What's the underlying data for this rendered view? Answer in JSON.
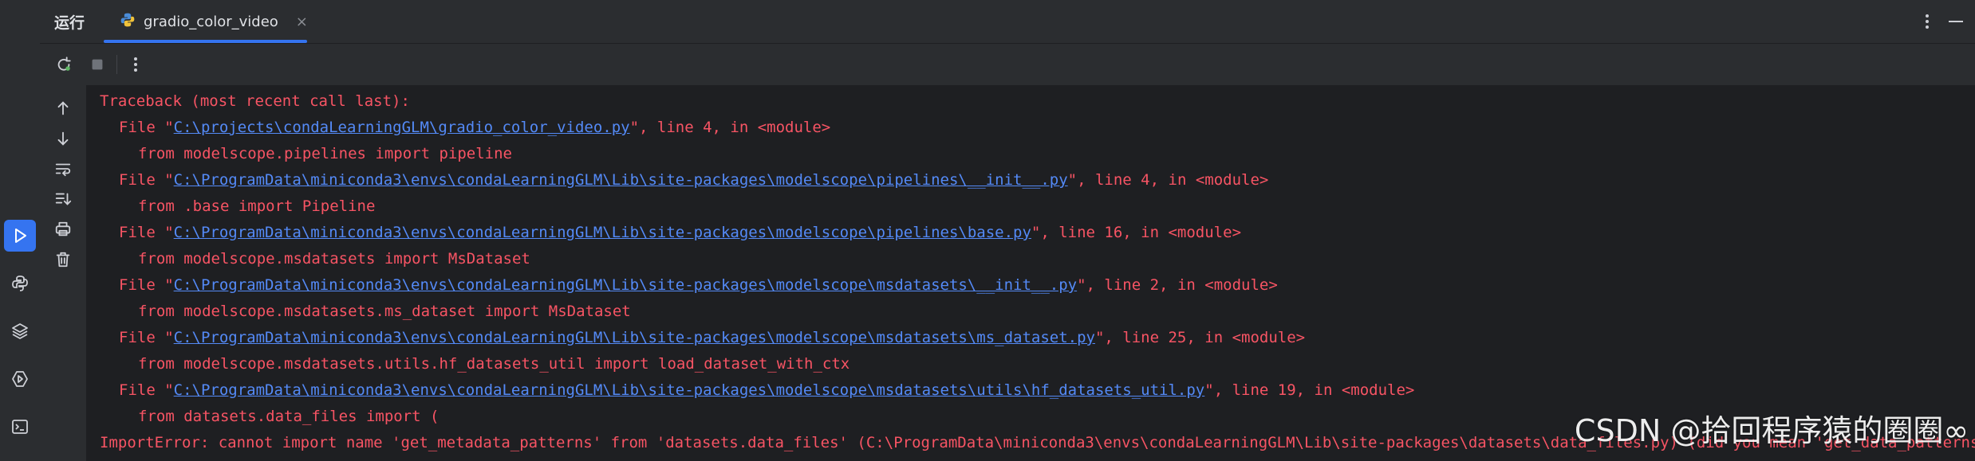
{
  "header": {
    "run_title": "运行",
    "tab_label": "gradio_color_video",
    "tab_close": "×"
  },
  "icons": {
    "activity": [
      "run-icon",
      "python-packages-icon",
      "layers-icon",
      "services-icon",
      "terminal-icon"
    ],
    "toolbar": [
      "rerun-icon",
      "stop-icon",
      "more-icon"
    ],
    "sidebar": [
      "scroll-up-icon",
      "scroll-down-icon",
      "soft-wrap-icon",
      "scroll-to-end-icon",
      "print-icon",
      "clear-all-icon"
    ]
  },
  "colors": {
    "error_text": "#f75464",
    "link": "#548af7",
    "accent": "#3574f0",
    "panel_bg": "#2b2d30",
    "console_bg": "#1e1f22"
  },
  "console": {
    "lines": [
      {
        "indent": 0,
        "pre": "Traceback (most recent call last):",
        "link": "",
        "post": ""
      },
      {
        "indent": 1,
        "pre": "File \"",
        "link": "C:\\projects\\condaLearningGLM\\gradio_color_video.py",
        "post": "\", line 4, in <module>"
      },
      {
        "indent": 2,
        "pre": "from modelscope.pipelines import pipeline",
        "link": "",
        "post": ""
      },
      {
        "indent": 1,
        "pre": "File \"",
        "link": "C:\\ProgramData\\miniconda3\\envs\\condaLearningGLM\\Lib\\site-packages\\modelscope\\pipelines\\__init__.py",
        "post": "\", line 4, in <module>"
      },
      {
        "indent": 2,
        "pre": "from .base import Pipeline",
        "link": "",
        "post": ""
      },
      {
        "indent": 1,
        "pre": "File \"",
        "link": "C:\\ProgramData\\miniconda3\\envs\\condaLearningGLM\\Lib\\site-packages\\modelscope\\pipelines\\base.py",
        "post": "\", line 16, in <module>"
      },
      {
        "indent": 2,
        "pre": "from modelscope.msdatasets import MsDataset",
        "link": "",
        "post": ""
      },
      {
        "indent": 1,
        "pre": "File \"",
        "link": "C:\\ProgramData\\miniconda3\\envs\\condaLearningGLM\\Lib\\site-packages\\modelscope\\msdatasets\\__init__.py",
        "post": "\", line 2, in <module>"
      },
      {
        "indent": 2,
        "pre": "from modelscope.msdatasets.ms_dataset import MsDataset",
        "link": "",
        "post": ""
      },
      {
        "indent": 1,
        "pre": "File \"",
        "link": "C:\\ProgramData\\miniconda3\\envs\\condaLearningGLM\\Lib\\site-packages\\modelscope\\msdatasets\\ms_dataset.py",
        "post": "\", line 25, in <module>"
      },
      {
        "indent": 2,
        "pre": "from modelscope.msdatasets.utils.hf_datasets_util import load_dataset_with_ctx",
        "link": "",
        "post": ""
      },
      {
        "indent": 1,
        "pre": "File \"",
        "link": "C:\\ProgramData\\miniconda3\\envs\\condaLearningGLM\\Lib\\site-packages\\modelscope\\msdatasets\\utils\\hf_datasets_util.py",
        "post": "\", line 19, in <module>"
      },
      {
        "indent": 2,
        "pre": "from datasets.data_files import (",
        "link": "",
        "post": ""
      },
      {
        "indent": 0,
        "pre": "ImportError: cannot import name 'get_metadata_patterns' from 'datasets.data_files' (C:\\ProgramData\\miniconda3\\envs\\condaLearningGLM\\Lib\\site-packages\\datasets\\data_files.py) (did you mean 'get_data_patterns'?)",
        "link": "",
        "post": ""
      }
    ]
  },
  "watermark": "CSDN @拾回程序猿的圈圈∞"
}
